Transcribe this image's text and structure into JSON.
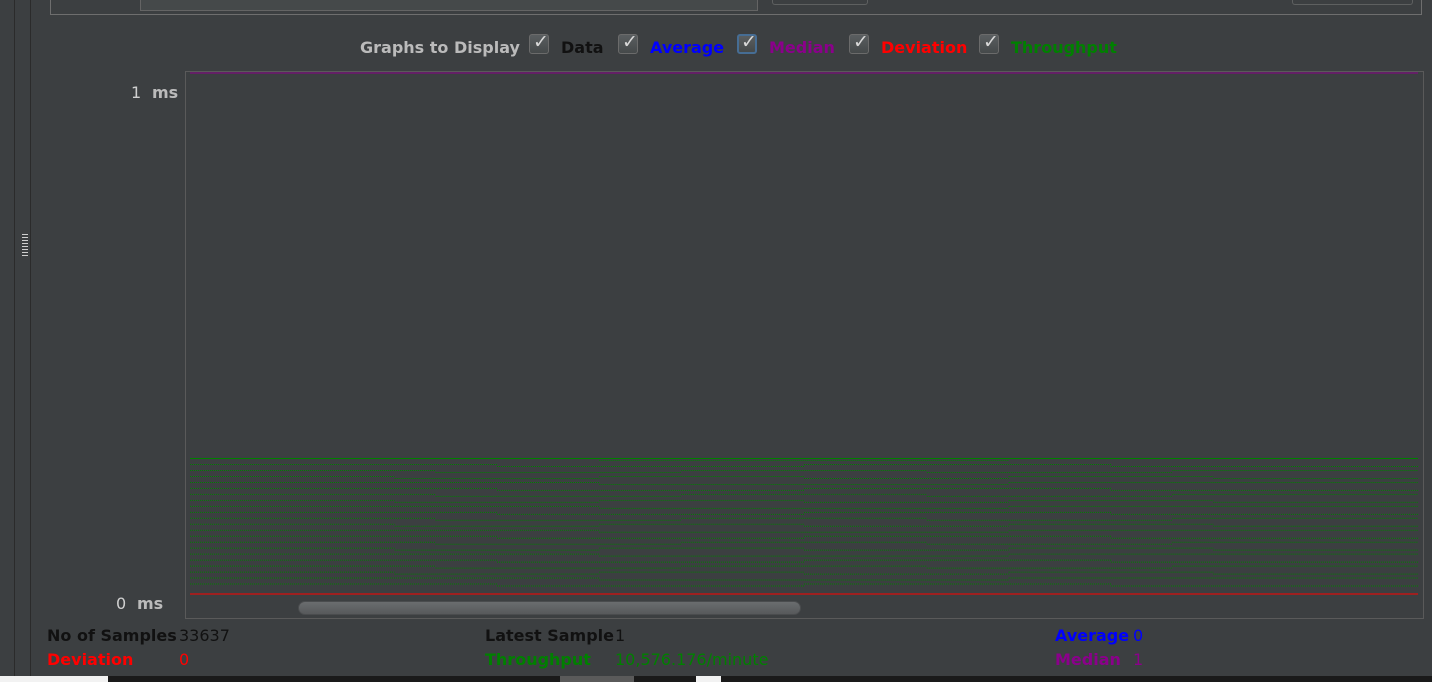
{
  "colors": {
    "data": "#111111",
    "average": "#0000ff",
    "median": "#8b008b",
    "deviation": "#ff0000",
    "throughput": "#008000",
    "label": "#bbbbbb",
    "background": "#3c3f41"
  },
  "graphs_to_display": {
    "label": "Graphs to Display",
    "options": [
      {
        "label": "Data",
        "checked": true
      },
      {
        "label": "Average",
        "checked": true
      },
      {
        "label": "Median",
        "checked": true
      },
      {
        "label": "Deviation",
        "checked": true
      },
      {
        "label": "Throughput",
        "checked": true
      }
    ]
  },
  "chart_data": {
    "type": "line",
    "y_axis": {
      "max_label": "1",
      "min_label": "0",
      "unit": "ms",
      "ylim": [
        0,
        1
      ]
    },
    "series": [
      {
        "name": "Median",
        "values": [
          1,
          1
        ]
      },
      {
        "name": "Deviation",
        "values": [
          0,
          0
        ]
      },
      {
        "name": "Throughput",
        "values": [
          0.26,
          0.26
        ]
      }
    ]
  },
  "stats": {
    "samples": {
      "label": "No of Samples",
      "value": "33637"
    },
    "latest": {
      "label": "Latest Sample",
      "value": "1"
    },
    "average": {
      "label": "Average",
      "value": "0"
    },
    "deviation": {
      "label": "Deviation",
      "value": "0"
    },
    "throughput": {
      "label": "Throughput",
      "value": "10,576.176/minute"
    },
    "median": {
      "label": "Median",
      "value": "1"
    }
  }
}
